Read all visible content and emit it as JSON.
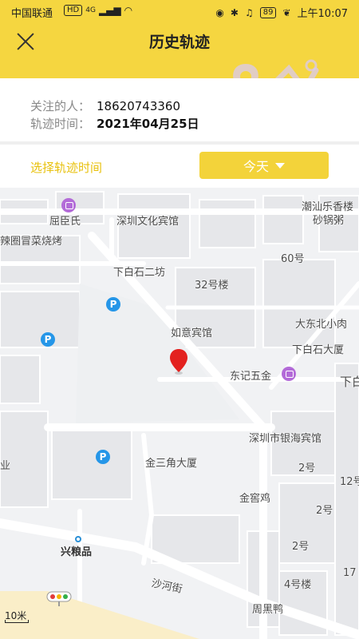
{
  "status_bar": {
    "carrier": "中国联通",
    "network_badge": "HD",
    "network_type": "4G",
    "battery": "89",
    "time": "上午10:07"
  },
  "header": {
    "title": "历史轨迹",
    "close_icon": "close-icon",
    "background_color": "#f5d640"
  },
  "info": {
    "follower_label": "关注的人：",
    "follower_value": "18620743360",
    "date_label": "轨迹时间：",
    "date_value": "2021年04月25日"
  },
  "selector": {
    "label": "选择轨迹时间",
    "dropdown_value": "今天",
    "dropdown_icon": "chevron-down-icon",
    "accent_color": "#f3d33a"
  },
  "map": {
    "labels": [
      "屈臣氏",
      "深圳文化宾馆",
      "潮汕乐香楼",
      "砂锅粥",
      "辣圈冒菜烧烤",
      "60号",
      "下白石二坊",
      "32号楼",
      "大东北小肉",
      "如意宾馆",
      "下白石大厦",
      "东记五金",
      "下白",
      "深圳市银海宾馆",
      "业",
      "金三角大厦",
      "2号",
      "12号",
      "金窖鸡",
      "2号",
      "兴粮品",
      "2号",
      "17",
      "4号楼",
      "沙河街",
      "周黑鸭"
    ],
    "scale": "10米",
    "marker_icon": "location-pin-icon",
    "traffic_icon": "traffic-light-icon"
  }
}
